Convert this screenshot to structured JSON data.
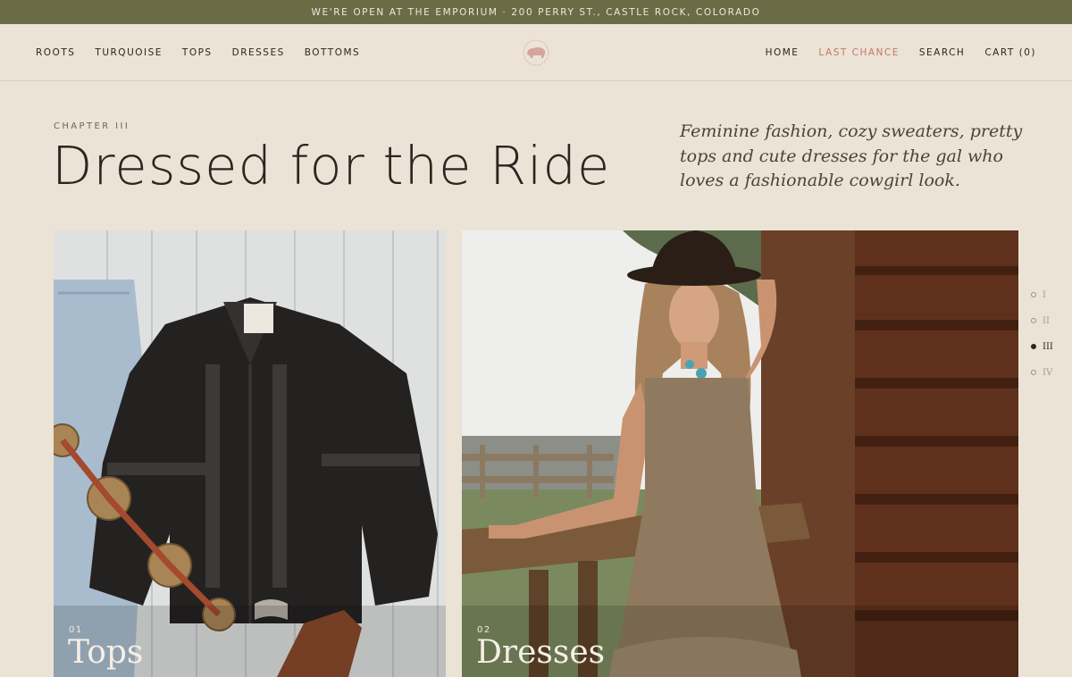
{
  "announcement": "WE'RE OPEN AT THE EMPORIUM · 200 PERRY ST., CASTLE ROCK, COLORADO",
  "nav_left": [
    "ROOTS",
    "TURQUOISE",
    "TOPS",
    "DRESSES",
    "BOTTOMS"
  ],
  "nav_right": {
    "home": "HOME",
    "last_chance": "LAST CHANCE",
    "search": "SEARCH",
    "cart": "CART (0)"
  },
  "colors": {
    "announcement_bg": "#6b6b46",
    "page_bg": "#ebe3d6",
    "accent": "#c4776b"
  },
  "logo": "buffalo-logo",
  "hero": {
    "eyebrow": "CHAPTER III",
    "title": "Dressed for the Ride",
    "description": "Feminine fashion, cozy sweaters, pretty tops and cute dresses for the gal who loves a fashionable cowgirl look."
  },
  "cards": [
    {
      "number": "01",
      "label": "Tops"
    },
    {
      "number": "02",
      "label": "Dresses"
    }
  ],
  "chapters": [
    {
      "label": "I",
      "active": false
    },
    {
      "label": "II",
      "active": false
    },
    {
      "label": "III",
      "active": true
    },
    {
      "label": "IV",
      "active": false
    }
  ]
}
